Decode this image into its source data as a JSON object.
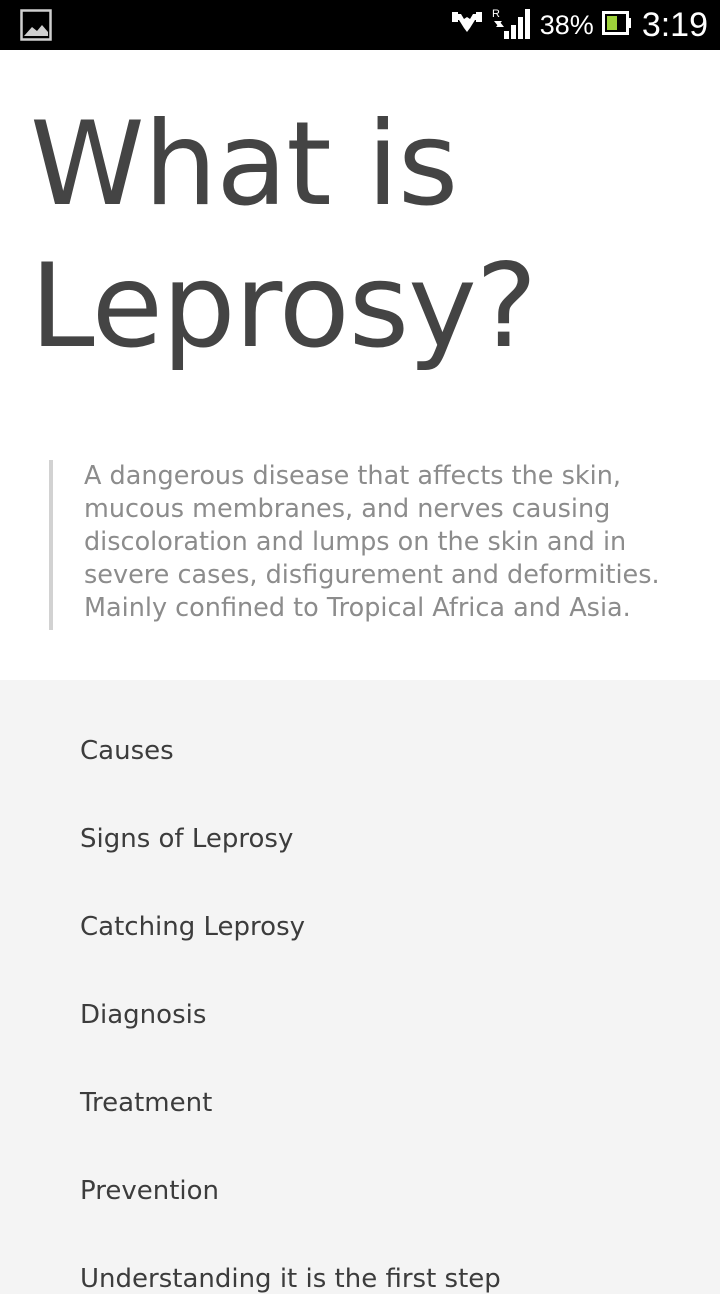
{
  "status_bar": {
    "notification_icon": "image-icon",
    "icons": [
      "handshake-icon",
      "signal-roaming-icon",
      "battery-icon"
    ],
    "battery": "38%",
    "time": "3:19"
  },
  "page": {
    "title": "What is Leprosy?",
    "description": "A dangerous disease that affects the skin, mucous membranes, and nerves causing discoloration and lumps on the skin and in severe cases, disfigurement and deformities. Mainly confined to Tropical Africa and Asia."
  },
  "menu": {
    "items": [
      "Causes",
      "Signs of Leprosy",
      "Catching Leprosy",
      "Diagnosis",
      "Treatment",
      "Prevention",
      "Understanding it is the first step"
    ]
  }
}
